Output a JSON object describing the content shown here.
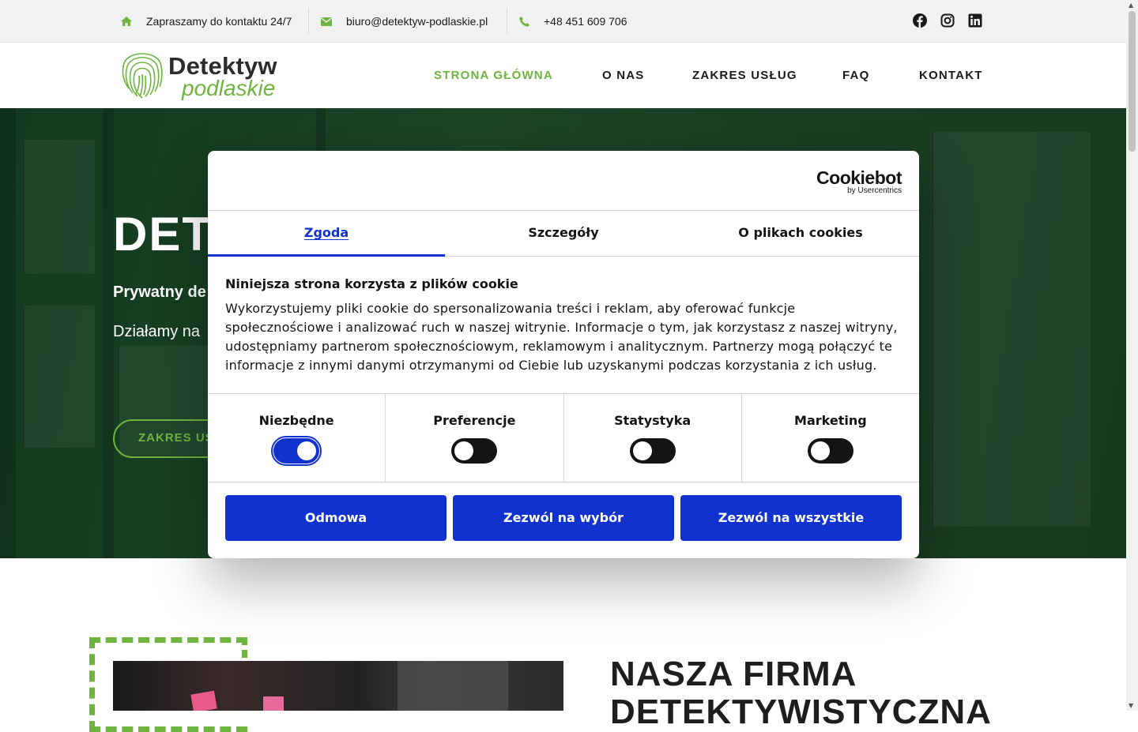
{
  "topbar": {
    "invite": "Zapraszamy do kontaktu 24/7",
    "email": "biuro@detektyw-podlaskie.pl",
    "phone": "+48 451 609 706",
    "icons": [
      "home-icon",
      "envelope-icon",
      "phone-icon",
      "facebook-icon",
      "instagram-icon",
      "linkedin-icon"
    ]
  },
  "header": {
    "logo_title": "Detektyw",
    "logo_sub": "podlaskie",
    "nav": [
      "STRONA GŁÓWNA",
      "O NAS",
      "ZAKRES USŁUG",
      "FAQ",
      "KONTAKT"
    ],
    "active_nav": "STRONA GŁÓWNA"
  },
  "hero": {
    "title": "DET",
    "subtitle": "Prywatny de",
    "text": "Działamy na",
    "button": "ZAKRES US"
  },
  "section": {
    "title_line1": "NASZA FIRMA",
    "title_line2": "DETEKTYWISTYCZNA"
  },
  "cookie": {
    "brand": "Cookiebot",
    "brand_by": "by Usercentrics",
    "tabs": [
      "Zgoda",
      "Szczegóły",
      "O plikach cookies"
    ],
    "active_tab": "Zgoda",
    "heading": "Niniejsza strona korzysta z plików cookie",
    "body": "Wykorzystujemy pliki cookie do spersonalizowania treści i reklam, aby oferować funkcje społecznościowe i analizować ruch w naszej witrynie. Informacje o tym, jak korzystasz z naszej witryny, udostępniamy partnerom społecznościowym, reklamowym i analitycznym. Partnerzy mogą połączyć te informacje z innymi danymi otrzymanymi od Ciebie lub uzyskanymi podczas korzystania z ich usług.",
    "categories": [
      {
        "label": "Niezbędne",
        "enabled": true
      },
      {
        "label": "Preferencje",
        "enabled": false
      },
      {
        "label": "Statystyka",
        "enabled": false
      },
      {
        "label": "Marketing",
        "enabled": false
      }
    ],
    "buttons": [
      "Odmowa",
      "Zezwól na wybór",
      "Zezwól na wszystkie"
    ]
  },
  "colors": {
    "accent_green": "#6fb43f",
    "cookie_blue": "#1032cf",
    "hero_bg": "#1c4427"
  }
}
